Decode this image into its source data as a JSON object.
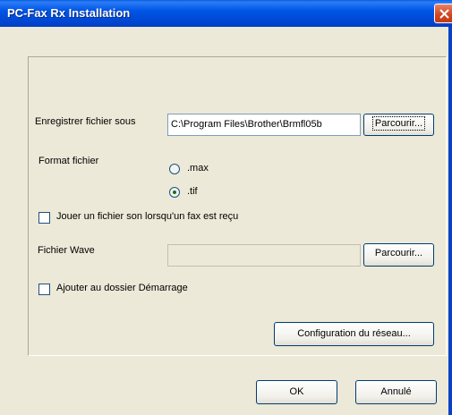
{
  "window": {
    "title": "PC-Fax Rx Installation"
  },
  "save": {
    "label": "Enregistrer fichier sous",
    "path": "C:\\Program Files\\Brother\\Brmfl05b",
    "browse_label": "Parcourir..."
  },
  "format": {
    "label": "Format fichier",
    "options": [
      {
        "label": ".max",
        "selected": false
      },
      {
        "label": ".tif",
        "selected": true
      }
    ]
  },
  "sound_checkbox": {
    "label": "Jouer un fichier son lorsqu'un fax est reçu",
    "checked": false
  },
  "wave": {
    "label": "Fichier Wave",
    "value": "",
    "browse_label": "Parcourir..."
  },
  "startup_checkbox": {
    "label": "Ajouter au dossier Démarrage",
    "checked": false
  },
  "network_button": "Configuration du réseau...",
  "ok_button": "OK",
  "cancel_button": "Annulé",
  "colors": {
    "titlebar": "#0055e5",
    "dialog_bg": "#ece9d8",
    "close": "#d0461f"
  }
}
